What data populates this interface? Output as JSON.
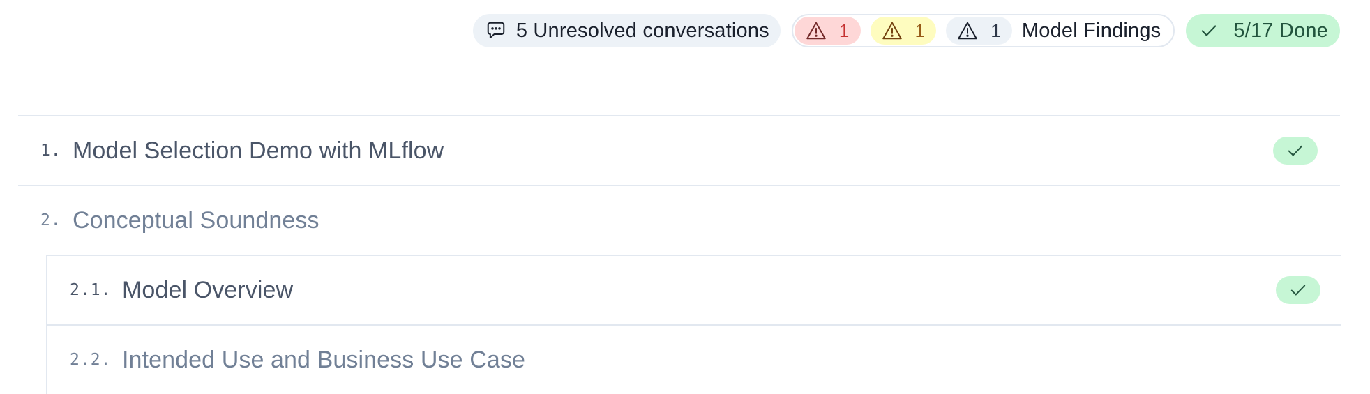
{
  "status": {
    "conversations_label": "5 Unresolved conversations",
    "findings": {
      "high_count": "1",
      "medium_count": "1",
      "low_count": "1",
      "label": "Model Findings"
    },
    "done_label": "5/17 Done"
  },
  "colors": {
    "high": "#fed7d7",
    "medium": "#fefcbf",
    "low": "#edf2f7",
    "done": "#c6f6d5"
  },
  "icons": {
    "conversations": "chat-bubble-icon",
    "severity": "warning-triangle-icon",
    "done": "checkmark-icon"
  },
  "outline": {
    "sections": [
      {
        "number": "1.",
        "title": "Model Selection Demo with MLflow",
        "status": "done"
      },
      {
        "number": "2.",
        "title": "Conceptual Soundness",
        "status": "none"
      }
    ],
    "subsections": [
      {
        "number": "2.1.",
        "title": "Model Overview",
        "status": "done"
      },
      {
        "number": "2.2.",
        "title": "Intended Use and Business Use Case",
        "status": "none"
      }
    ]
  }
}
